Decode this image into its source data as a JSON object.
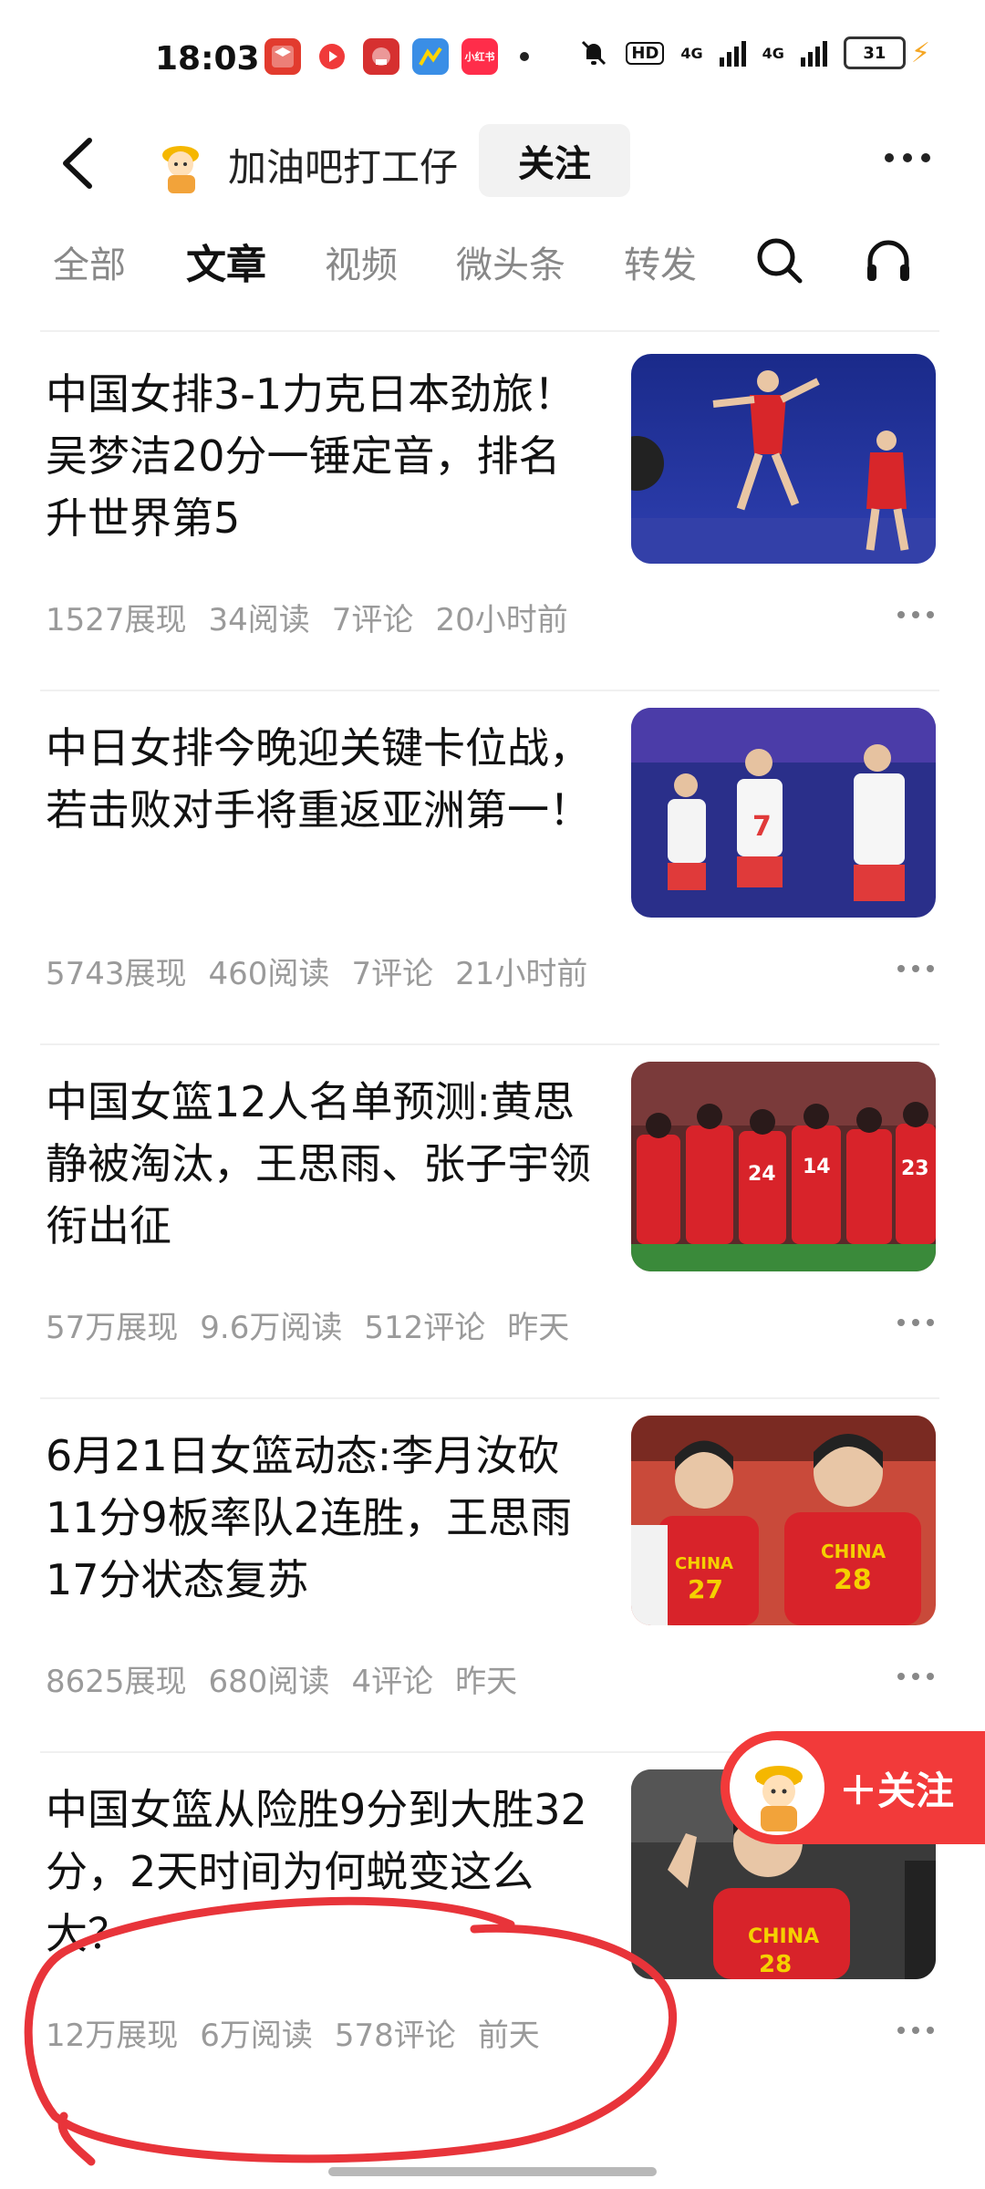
{
  "status_bar": {
    "time": "18:03",
    "apps": [
      {
        "name": "app-icon-1",
        "color": "#e23b2e",
        "label": ""
      },
      {
        "name": "app-icon-2",
        "color": "#f03a3a",
        "label": ""
      },
      {
        "name": "app-icon-3",
        "color": "#d63030",
        "label": ""
      },
      {
        "name": "app-icon-4",
        "color": "#3a8ee6",
        "label": ""
      },
      {
        "name": "app-icon-5",
        "color": "#ff2d4a",
        "label": "小红书"
      }
    ],
    "hd_label": "HD",
    "network_1": "4G",
    "network_2": "4G",
    "battery": "31"
  },
  "header": {
    "account_name": "加油吧打工仔",
    "follow_label": "关注"
  },
  "tabs": [
    {
      "label": "全部",
      "active": false
    },
    {
      "label": "文章",
      "active": true
    },
    {
      "label": "视频",
      "active": false
    },
    {
      "label": "微头条",
      "active": false
    },
    {
      "label": "转发",
      "active": false
    }
  ],
  "articles": [
    {
      "title": "中国女排3-1力克日本劲旅！吴梦洁20分一锤定音，排名升世界第5",
      "views": "1527展现",
      "reads": "34阅读",
      "comments": "7评论",
      "time": "20小时前"
    },
    {
      "title": "中日女排今晚迎关键卡位战，若击败对手将重返亚洲第一！",
      "views": "5743展现",
      "reads": "460阅读",
      "comments": "7评论",
      "time": "21小时前"
    },
    {
      "title": "中国女篮12人名单预测:黄思静被淘汰，王思雨、张子宇领衔出征",
      "views": "57万展现",
      "reads": "9.6万阅读",
      "comments": "512评论",
      "time": "昨天"
    },
    {
      "title": "6月21日女篮动态:李月汝砍11分9板率队2连胜，王思雨17分状态复苏",
      "views": "8625展现",
      "reads": "680阅读",
      "comments": "4评论",
      "time": "昨天"
    },
    {
      "title": "中国女篮从险胜9分到大胜32分，2天时间为何蜕变这么大？",
      "views": "12万展现",
      "reads": "6万阅读",
      "comments": "578评论",
      "time": "前天"
    }
  ],
  "floating_follow": {
    "label": "＋关注"
  },
  "thumb_texts": {
    "t3_numbers": [
      "24",
      "14",
      "23"
    ],
    "t4_jersey_1": "CHINA",
    "t4_number_1": "27",
    "t4_jersey_2": "CHINA",
    "t4_number_2": "28",
    "t5_jersey": "CHINA",
    "t5_number": "28"
  },
  "colors": {
    "accent_red": "#f23a3a",
    "annotation_red": "#e8343a",
    "meta_gray": "#9a9a9a"
  }
}
